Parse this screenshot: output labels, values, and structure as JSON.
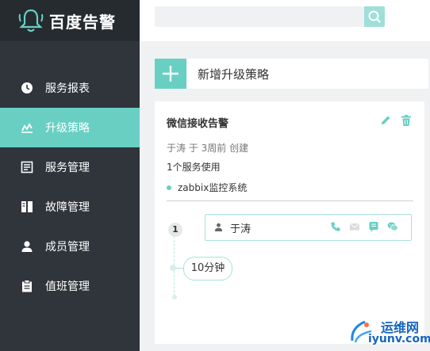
{
  "app": {
    "brand": "百度告警"
  },
  "sidebar": {
    "items": [
      {
        "label": "服务报表",
        "icon": "clock-icon"
      },
      {
        "label": "升级策略",
        "icon": "chart-icon"
      },
      {
        "label": "服务管理",
        "icon": "list-icon"
      },
      {
        "label": "故障管理",
        "icon": "columns-icon"
      },
      {
        "label": "成员管理",
        "icon": "user-icon"
      },
      {
        "label": "值班管理",
        "icon": "clipboard-icon"
      }
    ],
    "active_index": 1
  },
  "search": {
    "placeholder": "",
    "value": ""
  },
  "add_strategy": {
    "label": "新增升级策略"
  },
  "card": {
    "title": "微信接收告警",
    "meta": "于涛  于 3周前 创建",
    "usage": "1个服务使用",
    "service": "zabbix监控系统",
    "step_number": "1",
    "recipient": "于涛",
    "delay": "10分钟"
  },
  "watermark": {
    "line1": "运维网",
    "line2": "iyunv.com"
  },
  "colors": {
    "accent": "#69cfc3",
    "sidebar_bg": "#2f353b",
    "logo_bg": "#262b30"
  }
}
